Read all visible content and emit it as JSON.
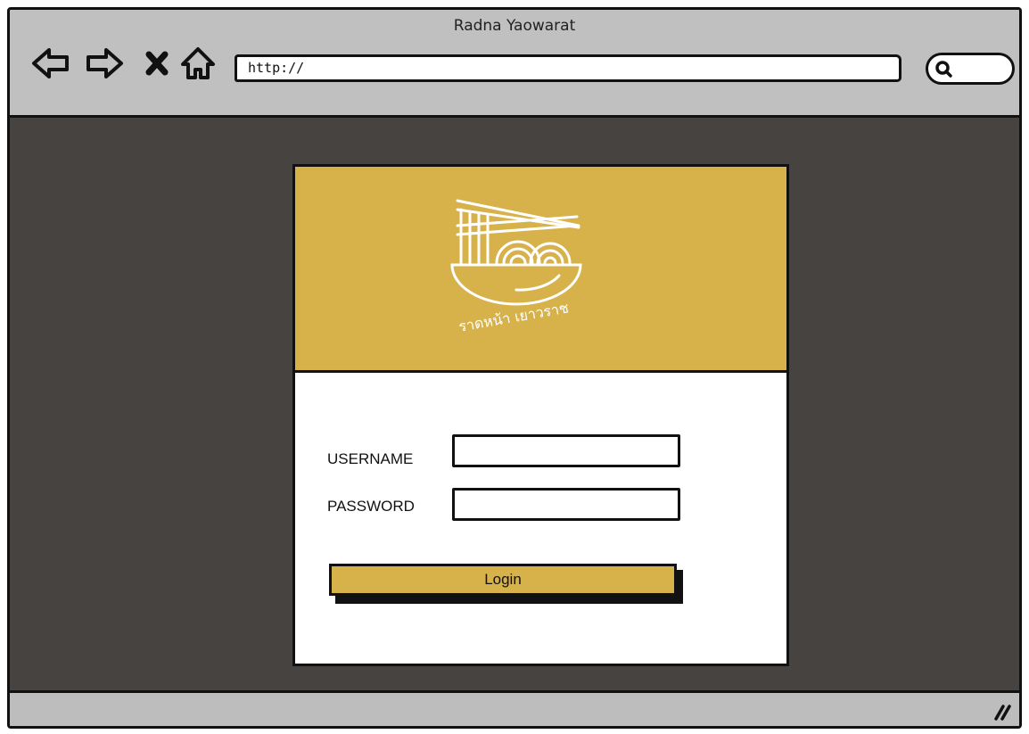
{
  "window": {
    "title": "Radna Yaowarat"
  },
  "toolbar": {
    "back_icon": "arrow-left-icon",
    "forward_icon": "arrow-right-icon",
    "stop_icon": "close-icon",
    "home_icon": "home-icon",
    "url": "http://",
    "search_icon": "search-icon"
  },
  "login_card": {
    "logo_text": "ราดหน้า เยาวราช",
    "username_label": "USERNAME",
    "username_value": "",
    "password_label": "PASSWORD",
    "password_value": "",
    "login_label": "Login"
  },
  "colors": {
    "accent": "#d7b24b",
    "background": "#474340",
    "chrome": "#c0c0c0"
  }
}
